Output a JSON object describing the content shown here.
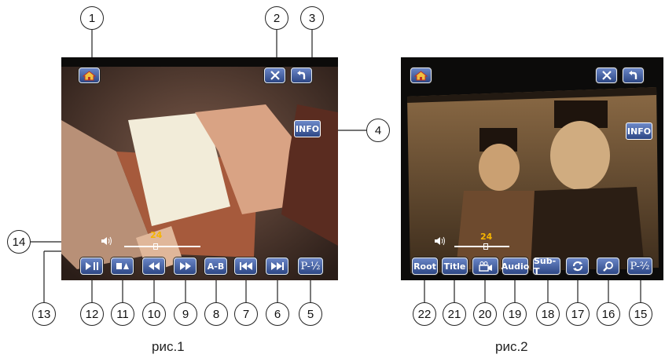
{
  "figure1": {
    "caption": "рис.1",
    "volume_icon": "speaker-icon",
    "progress_value": "24",
    "buttons": {
      "home": "home-icon",
      "settings": "tools-icon",
      "back": "return-arrow-icon",
      "info": "INFO",
      "play_pause": "play-pause-icon",
      "stop": "stop-eject-icon",
      "rewind": "rewind-icon",
      "fast_forward": "fast-forward-icon",
      "ab_repeat": "A-B",
      "prev": "previous-track-icon",
      "next": "next-track-icon",
      "page": "P-½"
    },
    "callouts": [
      "1",
      "2",
      "3",
      "4",
      "5",
      "6",
      "7",
      "8",
      "9",
      "10",
      "11",
      "12",
      "13",
      "14"
    ]
  },
  "figure2": {
    "caption": "рис.2",
    "volume_icon": "speaker-icon",
    "progress_value": "24",
    "buttons": {
      "home": "home-icon",
      "settings": "tools-icon",
      "back": "return-arrow-icon",
      "info": "INFO",
      "root": "Root",
      "title": "Title",
      "angle": "camera-angle-icon",
      "audio": "Audio",
      "subtitle": "Sub-T",
      "repeat": "repeat-icon",
      "zoom": "magnifier-icon",
      "page": "P-²⁄₂"
    },
    "callouts": [
      "15",
      "16",
      "17",
      "18",
      "19",
      "20",
      "21",
      "22"
    ]
  },
  "colors": {
    "button_top": "#6a86c7",
    "button_bottom": "#2d4785",
    "time_number": "#f5b400"
  }
}
